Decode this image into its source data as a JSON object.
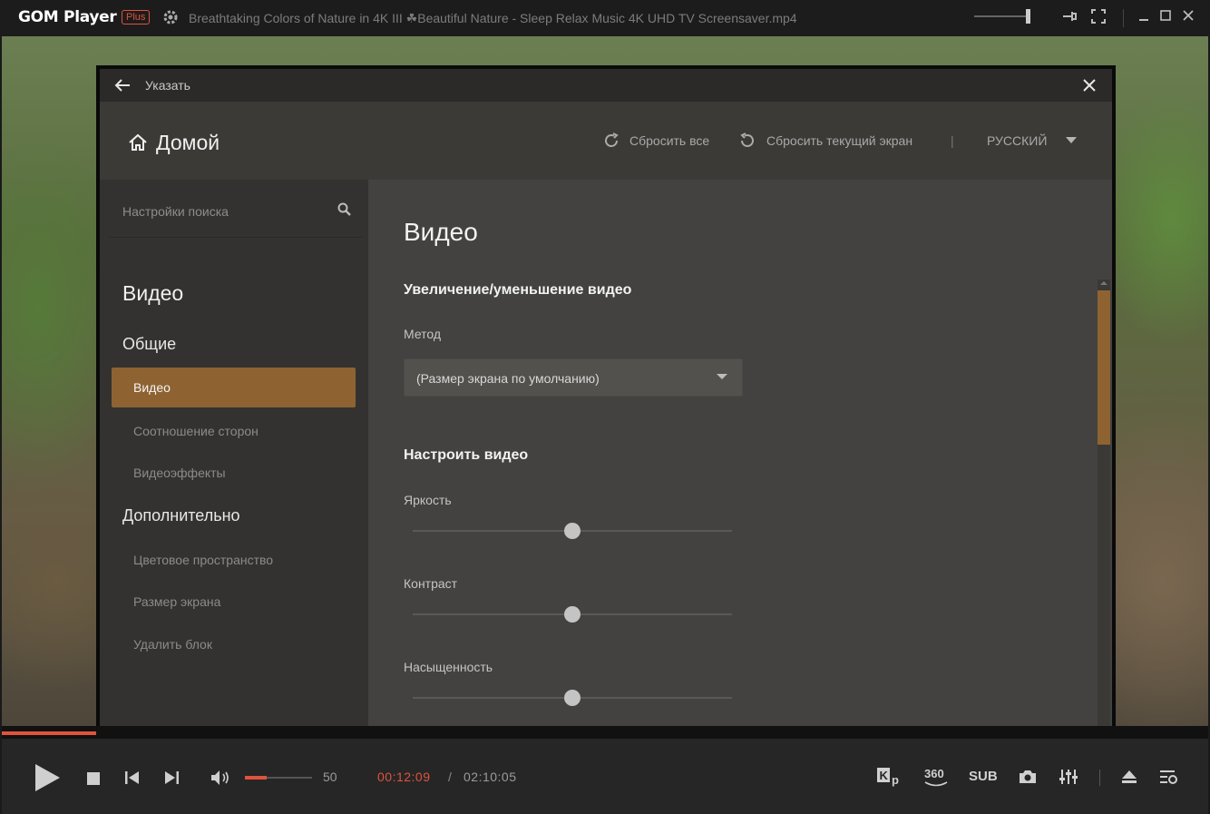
{
  "titlebar": {
    "app_name": "GOM Player",
    "badge": "Plus",
    "file_title": "Breathtaking Colors of Nature in 4K III ☘Beautiful Nature - Sleep Relax Music 4K UHD TV Screensaver.mp4",
    "icons": [
      "gear-icon",
      "pin-icon",
      "fullscreen-icon",
      "minimize-icon",
      "maximize-icon",
      "close-icon"
    ]
  },
  "dialog": {
    "title": "Указать",
    "home_label": "Домой",
    "reset_all": "Сбросить все",
    "reset_current": "Сбросить текущий экран",
    "separator": "|",
    "language": "РУССКИЙ"
  },
  "sidebar": {
    "search_placeholder": "Настройки поиска",
    "heading": "Видео",
    "groups": [
      {
        "title": "Общие",
        "items": [
          "Видео",
          "Соотношение сторон",
          "Видеоэффекты"
        ]
      },
      {
        "title": "Дополнительно",
        "items": [
          "Цветовое пространство",
          "Размер экрана",
          "Удалить блок"
        ]
      }
    ],
    "active_item": "Видео"
  },
  "content": {
    "title": "Видео",
    "section1": "Увеличение/уменьшение видео",
    "method_label": "Метод",
    "method_value": "(Размер экрана по умолчанию)",
    "section2": "Настроить видео",
    "sliders": [
      {
        "label": "Яркость",
        "value": 0.5
      },
      {
        "label": "Контраст",
        "value": 0.5
      },
      {
        "label": "Насыщенность",
        "value": 0.5
      }
    ]
  },
  "player": {
    "volume": "50",
    "volume_level": 0.33,
    "current_time": "00:12:09",
    "time_separator": "/",
    "total_time": "02:10:05",
    "progress": 0.078,
    "right_buttons": [
      "K p",
      "360",
      "SUB"
    ],
    "colors": {
      "accent": "#e0533d",
      "active": "#8e6331"
    }
  }
}
